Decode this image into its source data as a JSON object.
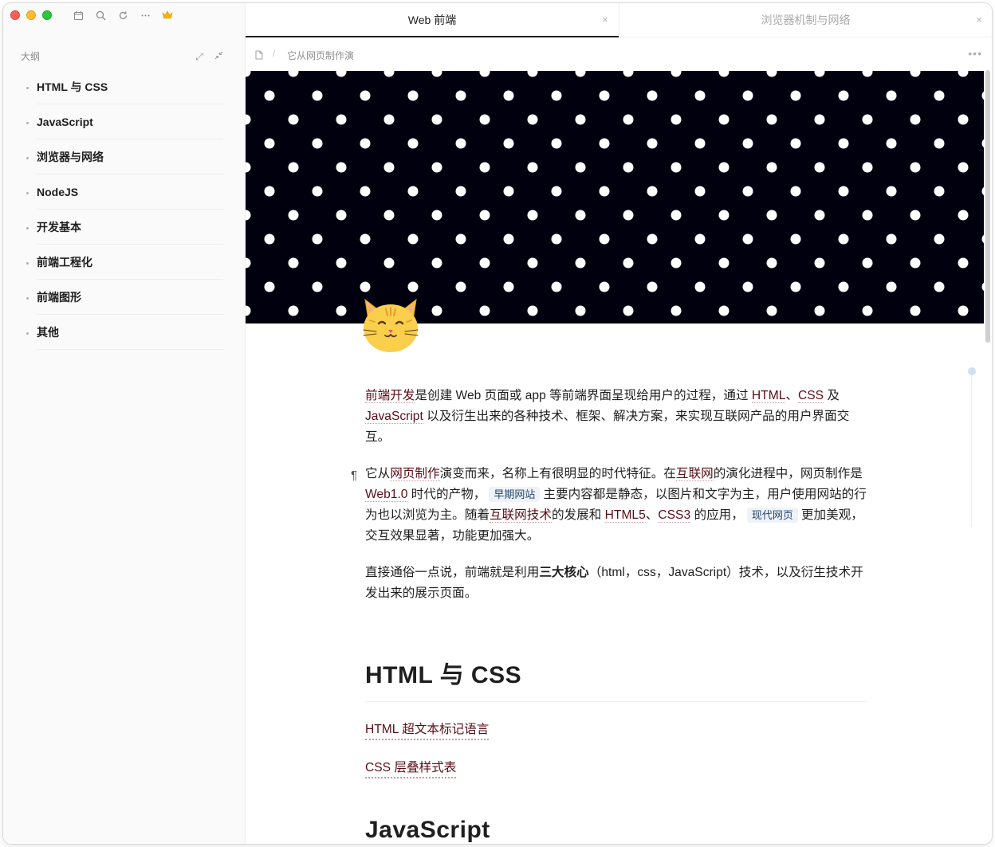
{
  "window": {
    "traffic_lights": [
      "close",
      "minimize",
      "zoom"
    ],
    "toolbar_icons": [
      "calendar-icon",
      "search-icon",
      "sync-icon",
      "more-icon",
      "crown-icon"
    ]
  },
  "sidebar": {
    "title": "大纲",
    "items": [
      {
        "label": "HTML 与 CSS"
      },
      {
        "label": "JavaScript"
      },
      {
        "label": "浏览器与网络"
      },
      {
        "label": "NodeJS"
      },
      {
        "label": "开发基本"
      },
      {
        "label": "前端工程化"
      },
      {
        "label": "前端图形"
      },
      {
        "label": "其他"
      }
    ]
  },
  "tabs": [
    {
      "label": "Web 前端",
      "active": true,
      "close": "×"
    },
    {
      "label": "浏览器机制与网络",
      "active": false,
      "close": "×"
    }
  ],
  "breadcrumb": {
    "separator": "/",
    "current": "它从网页制作演",
    "more": "•••"
  },
  "cover": {
    "background": "#00000f",
    "dot_color": "#ffffff"
  },
  "page_icon": "cat-face",
  "article": {
    "p1": {
      "link1": "前端开发",
      "t1": "是创建 Web 页面或 app 等前端界面呈现给用户的过程，通过 ",
      "link2": "HTML",
      "t2": "、",
      "link3": "CSS",
      "t3": " 及 ",
      "link4": "JavaScript",
      "t4": " 以及衍生出来的各种技术、框架、解决方案，来实现互联网产品的用户界面交互。"
    },
    "p2": {
      "pilcrow": "¶",
      "t1": "它从",
      "link1": "网页制作",
      "t2": "演变而来，名称上有很明显的时代特征。在",
      "link2": "互联网",
      "t3": "的演化进程中，网页制作是 ",
      "link3": "Web1.0",
      "t4": " 时代的产物，",
      "pill1": "早期网站",
      "t5": "主要内容都是静态，以图片和文字为主，用户使用网站的行为也以浏览为主。随着",
      "link4": "互联网技术",
      "t6": "的发展和 ",
      "link5": "HTML5",
      "t7": "、",
      "link6": "CSS3",
      "t8": " 的应用，",
      "pill2": "现代网页",
      "t9": "更加美观，交互效果显著，功能更加强大。"
    },
    "p3": {
      "t1": "直接通俗一点说，前端就是利用",
      "strong": "三大核心",
      "t2": "（html，css，JavaScript）技术，以及衍生技术开发出来的展示页面。"
    },
    "h2_html": "HTML 与 CSS",
    "link_html": "HTML 超文本标记语言",
    "link_css": "CSS 层叠样式表",
    "h2_js": "JavaScript"
  }
}
